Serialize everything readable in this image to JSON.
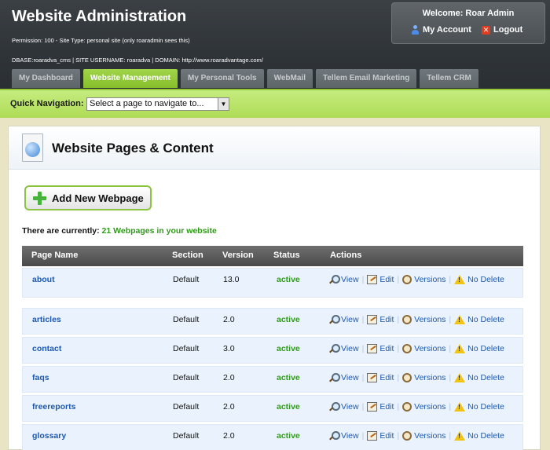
{
  "header": {
    "title": "Website Administration",
    "permission": "Permission: 100 - Site Type: personal site (only roaradmin sees this)",
    "dbase": "DBASE:roaradva_cms | SITE USERNAME: roaradva | DOMAIN: http://www.roaradvantage.com/"
  },
  "user": {
    "welcome": "Welcome: Roar Admin",
    "my_account": "My Account",
    "logout": "Logout"
  },
  "tabs": [
    {
      "label": "My Dashboard"
    },
    {
      "label": "Website Management"
    },
    {
      "label": "My Personal Tools"
    },
    {
      "label": "WebMail"
    },
    {
      "label": "Tellem Email Marketing"
    },
    {
      "label": "Tellem CRM"
    }
  ],
  "quick_nav": {
    "label": "Quick Navigation:",
    "selected": "Select a page to navigate to..."
  },
  "content": {
    "title": "Website Pages & Content",
    "add_button": "Add New Webpage",
    "count_prefix": "There are currently:",
    "count_value": "21 Webpages in your website"
  },
  "table": {
    "headers": [
      "Page Name",
      "Section",
      "Version",
      "Status",
      "Actions"
    ],
    "actions": {
      "view": "View",
      "edit": "Edit",
      "versions": "Versions",
      "delete": "No Delete"
    },
    "rows": [
      {
        "name": "about",
        "section": "Default",
        "version": "13.0",
        "status": "active"
      },
      {
        "name": "articles",
        "section": "Default",
        "version": "2.0",
        "status": "active"
      },
      {
        "name": "contact",
        "section": "Default",
        "version": "3.0",
        "status": "active"
      },
      {
        "name": "faqs",
        "section": "Default",
        "version": "2.0",
        "status": "active"
      },
      {
        "name": "freereports",
        "section": "Default",
        "version": "2.0",
        "status": "active"
      },
      {
        "name": "glossary",
        "section": "Default",
        "version": "2.0",
        "status": "active"
      }
    ]
  },
  "colors": {
    "accent_green": "#8bc441",
    "link_blue": "#1d59b0",
    "status_green": "#2f9a18"
  }
}
